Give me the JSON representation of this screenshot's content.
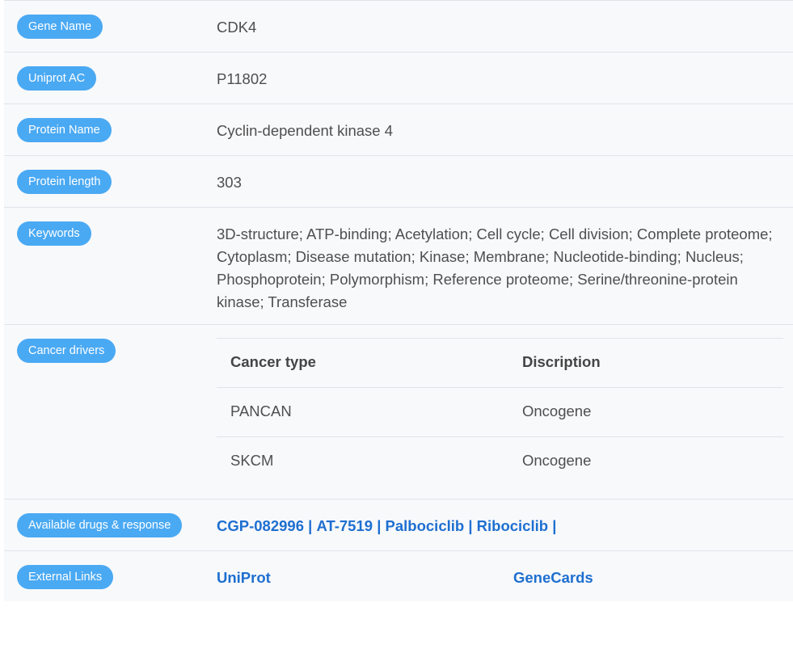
{
  "rows": {
    "gene_name": {
      "label": "Gene Name",
      "value": "CDK4"
    },
    "uniprot_ac": {
      "label": "Uniprot AC",
      "value": "P11802"
    },
    "protein_name": {
      "label": "Protein Name",
      "value": "Cyclin-dependent kinase 4"
    },
    "protein_length": {
      "label": "Protein length",
      "value": "303"
    },
    "keywords": {
      "label": "Keywords",
      "value": "3D-structure; ATP-binding; Acetylation; Cell cycle; Cell division; Complete proteome; Cytoplasm; Disease mutation; Kinase; Membrane; Nucleotide-binding; Nucleus; Phosphoprotein; Polymorphism; Reference proteome; Serine/threonine-protein kinase; Transferase"
    },
    "cancer_drivers": {
      "label": "Cancer drivers",
      "headers": [
        "Cancer type",
        "Discription"
      ],
      "rows": [
        [
          "PANCAN",
          "Oncogene"
        ],
        [
          "SKCM",
          "Oncogene"
        ]
      ]
    },
    "drugs": {
      "label": "Available drugs & response",
      "items": [
        "CGP-082996",
        "AT-7519",
        "Palbociclib",
        "Ribociclib"
      ],
      "separator": "|"
    },
    "external": {
      "label": "External Links",
      "links": [
        "UniProt",
        "GeneCards"
      ]
    }
  },
  "colors": {
    "badge": "#4aa9f3",
    "link": "#1e6fd0",
    "row_bg": "#f8f9fb",
    "border": "#dfe3e8"
  }
}
